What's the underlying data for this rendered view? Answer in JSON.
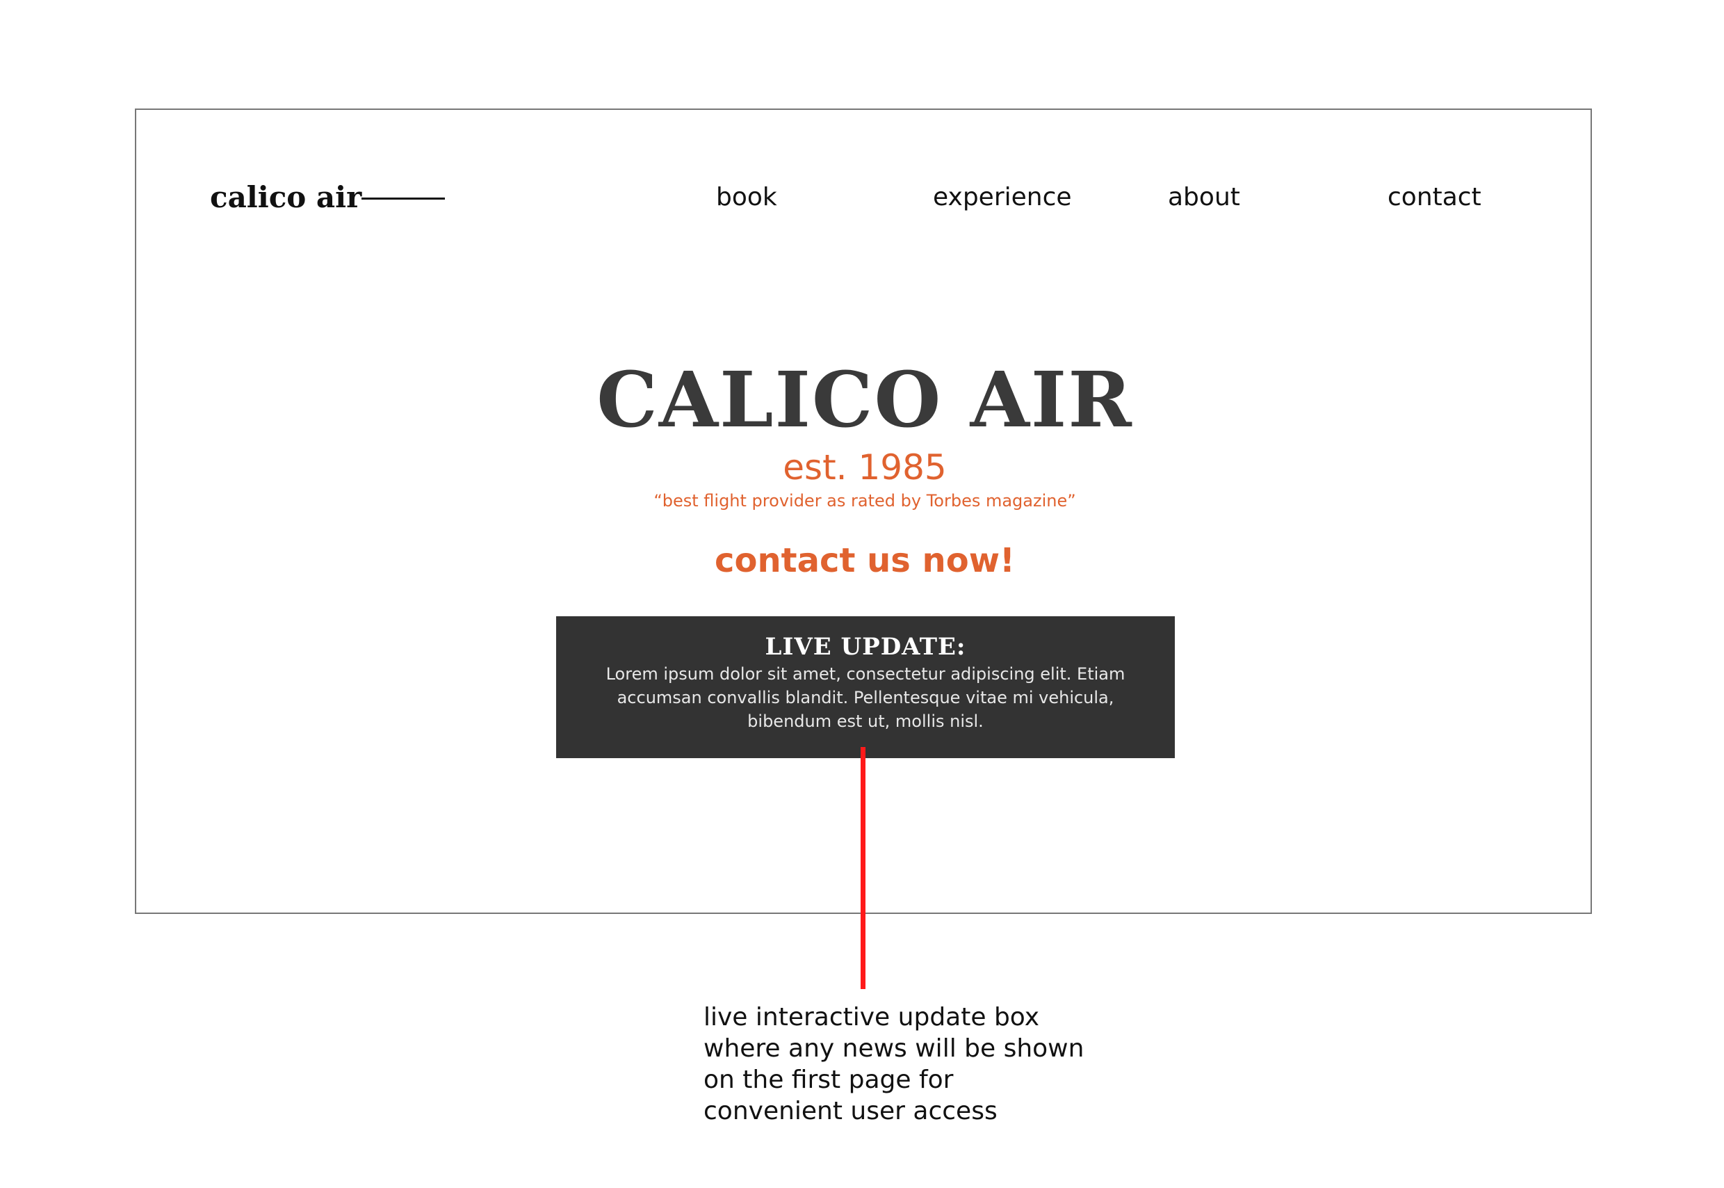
{
  "header": {
    "logo_text": "calico air",
    "nav": [
      {
        "label": "book"
      },
      {
        "label": "experience"
      },
      {
        "label": "about"
      },
      {
        "label": "contact"
      }
    ]
  },
  "hero": {
    "title": "CALICO AIR",
    "established": "est. 1985",
    "tagline": "“best flight provider as rated by Torbes magazine”",
    "cta_label": "contact us now!"
  },
  "live_update": {
    "title": "LIVE UPDATE:",
    "body": "Lorem ipsum dolor sit amet, consectetur adipiscing elit. Etiam accumsan convallis blandit. Pellentesque vitae mi vehicula, bibendum est ut, mollis nisl."
  },
  "annotation": {
    "text": "live interactive update box where any news will be shown on the first page for convenient user access"
  },
  "colors": {
    "accent": "#e0622f",
    "title": "#3a3a3a",
    "update_box_bg": "#333333",
    "pointer": "#ff1a1a"
  }
}
